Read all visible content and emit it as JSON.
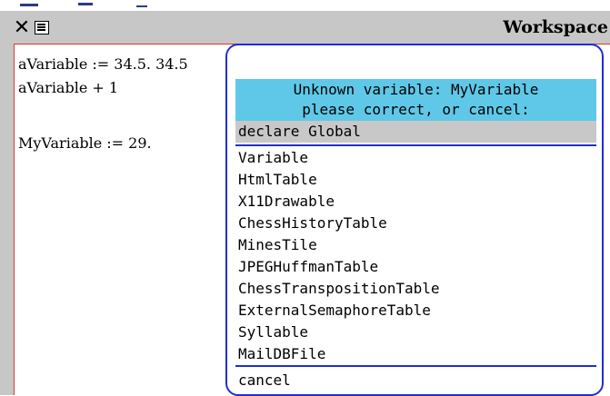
{
  "window": {
    "title": "Workspace",
    "close_icon": "close-icon",
    "menu_icon": "window-menu-icon"
  },
  "workspace": {
    "lines": [
      "aVariable := 34.5. 34.5",
      "aVariable + 1",
      "MyVariable := 29."
    ]
  },
  "popup": {
    "header_line1": "Unknown variable: MyVariable",
    "header_line2": "please correct, or cancel:",
    "declare_label": "declare Global",
    "items": [
      "Variable",
      "HtmlTable",
      "X11Drawable",
      "ChessHistoryTable",
      "MinesTile",
      "JPEGHuffmanTable",
      "ChessTranspositionTable",
      "ExternalSemaphoreTable",
      "Syllable",
      "MailDBFile"
    ],
    "cancel_label": "cancel"
  },
  "colors": {
    "titlebar": "#c7c7c7",
    "pane_border": "#d23a3a",
    "popup_border": "#1f2fcf",
    "header_bg": "#5fc8e8",
    "selected_bg": "#c8c8c8"
  }
}
